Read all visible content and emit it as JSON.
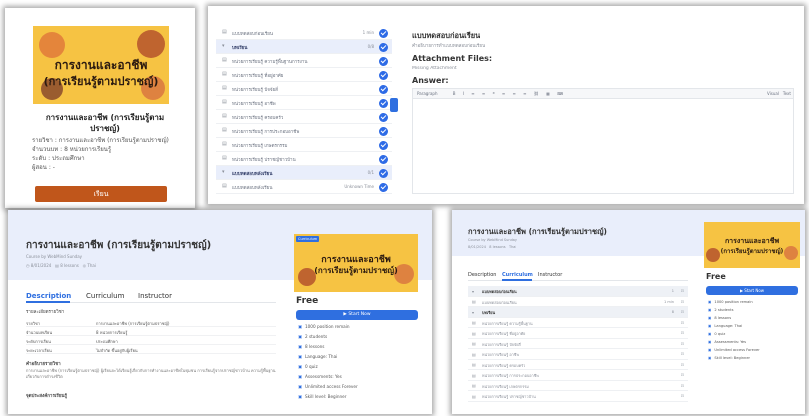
{
  "course_title": "การงานและอาชีพ (การเรียนรู้ตามปราชญ์)",
  "cover": {
    "line1": "การงานและอาชีพ",
    "line2": "(การเรียนรู้ตามปราชญ์)"
  },
  "card": {
    "title": "การงานและอาชีพ (การเรียนรู้ตามปราชญ์)",
    "meta": [
      {
        "label": "รายวิชา",
        "value": ": การงานและอาชีพ (การเรียนรู้ตามปราชญ์)"
      },
      {
        "label": "จำนวนบท",
        "value": ": 8 หน่วยการเรียนรู้"
      },
      {
        "label": "ระดับ",
        "value": ": ประถมศึกษา"
      },
      {
        "label": "ผู้สอน",
        "value": ": -"
      }
    ],
    "enroll_label": "เรียน"
  },
  "lesson_view": {
    "sidebar": [
      {
        "label": "แบบทดสอบก่อนเรียน",
        "meta": "1 min",
        "type": "item"
      },
      {
        "label": "บทเรียน",
        "meta": "0/8",
        "type": "section"
      },
      {
        "label": "หน่วยการเรียนรู้ ความรู้พื้นฐานการงาน",
        "type": "item"
      },
      {
        "label": "หน่วยการเรียนรู้ ที่อยู่อาศัย",
        "type": "item"
      },
      {
        "label": "หน่วยการเรียนรู้ ปัจจัยสี่",
        "type": "item"
      },
      {
        "label": "หน่วยการเรียนรู้ อาชีพ",
        "type": "item"
      },
      {
        "label": "หน่วยการเรียนรู้ ครอบครัว",
        "type": "item"
      },
      {
        "label": "หน่วยการเรียนรู้ การประกอบอาชีพ",
        "type": "item"
      },
      {
        "label": "หน่วยการเรียนรู้ เกษตรกรรม",
        "type": "item"
      },
      {
        "label": "หน่วยการเรียนรู้ ปราชญ์ชาวบ้าน",
        "type": "item"
      },
      {
        "label": "แบบทดสอบหลังเรียน",
        "meta": "0/1",
        "type": "section"
      },
      {
        "label": "แบบทดสอบหลังเรียน",
        "meta": "Unknown Time",
        "type": "item"
      }
    ],
    "heading": "แบบทดสอบก่อนเรียน",
    "subheading": "คำอธิบายการทำแบบทดสอบก่อนเรียน",
    "attachment_label": "Attachment Files:",
    "attachment_note": "Missing Attachment",
    "answer_label": "Answer:",
    "editor_paragraph": "Paragraph",
    "editor_visual": "Visual",
    "editor_text": "Text"
  },
  "course_page": {
    "author": "Course by WebMind Sunday",
    "date": "8/01/2024",
    "lessons": "8 lessons",
    "lang": "Thai",
    "tabs": [
      "Description",
      "Curriculum",
      "Instructor"
    ],
    "desc_heading": "รายละเอียดรายวิชา",
    "desc_rows": [
      {
        "label": "รายวิชา",
        "value": "การงานและอาชีพ (การเรียนรู้ตามปราชญ์)"
      },
      {
        "label": "จำนวนบทเรียน",
        "value": "8 หน่วยการเรียนรู้"
      },
      {
        "label": "ระดับการเรียน",
        "value": "ประถมศึกษา"
      },
      {
        "label": "ระยะเวลาเรียน",
        "value": "ไม่จำกัด ขึ้นอยู่กับผู้เรียน"
      }
    ],
    "about_heading": "คำอธิบายรายวิชา",
    "about_text": "การงานและอาชีพ (การเรียนรู้ตามปราชญ์) ผู้เรียนจะได้เรียนรู้เกี่ยวกับการทำงานและอาชีพในชุมชน การเรียนรู้จากปราชญ์ชาวบ้าน ความรู้พื้นฐานเกี่ยวกับการดำรงชีวิต",
    "goals_heading": "จุดประสงค์การเรียนรู้",
    "badge": "Curriculum",
    "price": "Free",
    "start_label": "Start Now",
    "features": [
      "1000 position remain",
      "2 students",
      "8 lessons",
      "Language: Thai",
      "0 quiz",
      "Assessments: Yes",
      "Unlimited access Forever",
      "Skill level: Beginner"
    ]
  },
  "curriculum_page": {
    "tabs": [
      "Description",
      "Curriculum",
      "Instructor"
    ],
    "sections": [
      {
        "label": "แบบทดสอบก่อนเรียน",
        "meta": "1",
        "type": "section"
      },
      {
        "label": "แบบทดสอบก่อนเรียน",
        "meta": "1 min",
        "type": "item"
      },
      {
        "label": "บทเรียน",
        "meta": "8",
        "type": "section"
      },
      {
        "label": "หน่วยการเรียนรู้ ความรู้พื้นฐาน",
        "type": "item"
      },
      {
        "label": "หน่วยการเรียนรู้ ที่อยู่อาศัย",
        "type": "item"
      },
      {
        "label": "หน่วยการเรียนรู้ ปัจจัยสี่",
        "type": "item"
      },
      {
        "label": "หน่วยการเรียนรู้ อาชีพ",
        "type": "item"
      },
      {
        "label": "หน่วยการเรียนรู้ ครอบครัว",
        "type": "item"
      },
      {
        "label": "หน่วยการเรียนรู้ การประกอบอาชีพ",
        "type": "item"
      },
      {
        "label": "หน่วยการเรียนรู้ เกษตรกรรม",
        "type": "item"
      },
      {
        "label": "หน่วยการเรียนรู้ ปราชญ์ชาวบ้าน",
        "type": "item"
      }
    ],
    "price": "Free",
    "start_label": "Start Now",
    "features": [
      "1000 position remain",
      "2 students",
      "8 lessons",
      "Language: Thai",
      "0 quiz",
      "Assessments: Yes",
      "Unlimited access Forever",
      "Skill level: Beginner"
    ]
  },
  "colors": {
    "accent": "#2f6fe0",
    "cover": "#f6c343",
    "enroll": "#c0561b"
  }
}
